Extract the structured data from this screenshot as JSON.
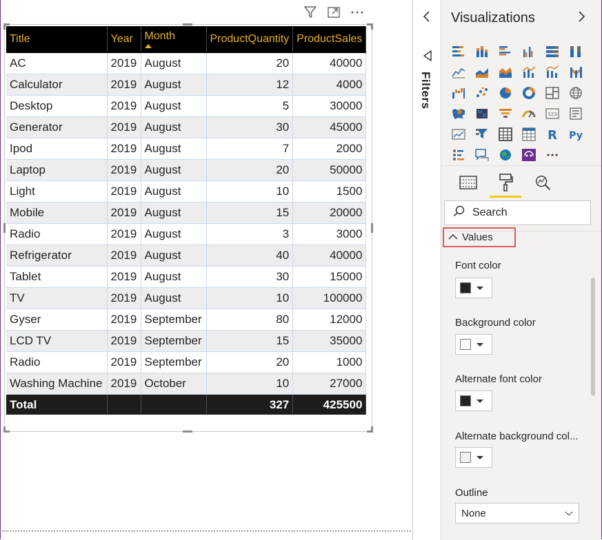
{
  "table": {
    "columns": [
      "Title",
      "Year",
      "Month",
      "ProductQuantity",
      "ProductSales"
    ],
    "sorted_column": "Month",
    "rows": [
      [
        "AC",
        "2019",
        "August",
        "20",
        "40000"
      ],
      [
        "Calculator",
        "2019",
        "August",
        "12",
        "4000"
      ],
      [
        "Desktop",
        "2019",
        "August",
        "5",
        "30000"
      ],
      [
        "Generator",
        "2019",
        "August",
        "30",
        "45000"
      ],
      [
        "Ipod",
        "2019",
        "August",
        "7",
        "2000"
      ],
      [
        "Laptop",
        "2019",
        "August",
        "20",
        "50000"
      ],
      [
        "Light",
        "2019",
        "August",
        "10",
        "1500"
      ],
      [
        "Mobile",
        "2019",
        "August",
        "15",
        "20000"
      ],
      [
        "Radio",
        "2019",
        "August",
        "3",
        "3000"
      ],
      [
        "Refrigerator",
        "2019",
        "August",
        "40",
        "40000"
      ],
      [
        "Tablet",
        "2019",
        "August",
        "30",
        "15000"
      ],
      [
        "TV",
        "2019",
        "August",
        "10",
        "100000"
      ],
      [
        "Gyser",
        "2019",
        "September",
        "80",
        "12000"
      ],
      [
        "LCD TV",
        "2019",
        "September",
        "15",
        "35000"
      ],
      [
        "Radio",
        "2019",
        "September",
        "20",
        "1000"
      ],
      [
        "Washing Machine",
        "2019",
        "October",
        "10",
        "27000"
      ]
    ],
    "total": [
      "Total",
      "",
      "",
      "327",
      "425500"
    ],
    "colors": {
      "header_bg": "#000000",
      "header_text": "#e8b22a",
      "alt_row_bg": "#ededed",
      "total_bg": "#1f1d1c"
    }
  },
  "visual_header": {
    "icons": [
      "filter-icon",
      "focus-mode-icon",
      "more-options-icon"
    ]
  },
  "filters_pane": {
    "label": "Filters",
    "collapse_icon": "chevron-left-icon"
  },
  "viz_pane": {
    "title": "Visualizations",
    "icons": [
      "stacked-bar-chart-icon",
      "stacked-column-chart-icon",
      "clustered-bar-chart-icon",
      "clustered-column-chart-icon",
      "100-stacked-bar-chart-icon",
      "100-stacked-column-chart-icon",
      "line-chart-icon",
      "area-chart-icon",
      "stacked-area-chart-icon",
      "line-clustered-column-icon",
      "line-stacked-column-icon",
      "ribbon-chart-icon",
      "waterfall-chart-icon",
      "scatter-chart-icon",
      "pie-chart-icon",
      "donut-chart-icon",
      "treemap-icon",
      "map-icon",
      "filled-map-icon",
      "shape-map-icon",
      "funnel-icon",
      "gauge-icon",
      "card-icon",
      "multi-row-card-icon",
      "kpi-icon",
      "slicer-icon",
      "table-icon",
      "matrix-icon",
      "r-visual-icon",
      "python-visual-icon",
      "key-influencers-icon",
      "qa-icon",
      "arcgis-map-icon",
      "custom-visual-icon",
      "more-visuals-icon"
    ],
    "tabs": [
      "fields-tab",
      "format-tab",
      "analytics-tab"
    ],
    "active_tab": "format-tab",
    "search_placeholder": "Search",
    "section": "Values",
    "properties": {
      "font_color_label": "Font color",
      "background_color_label": "Background color",
      "alt_font_color_label": "Alternate font color",
      "alt_background_color_label": "Alternate background col...",
      "outline_label": "Outline",
      "outline_value": "None"
    },
    "swatches": {
      "font_color": "#222222",
      "background_color": "#ffffff",
      "alt_font_color": "#222222",
      "alt_background_color": "#f0f0f0"
    },
    "accent_color": "#f2c811",
    "highlight_color": "#e05a5a"
  }
}
